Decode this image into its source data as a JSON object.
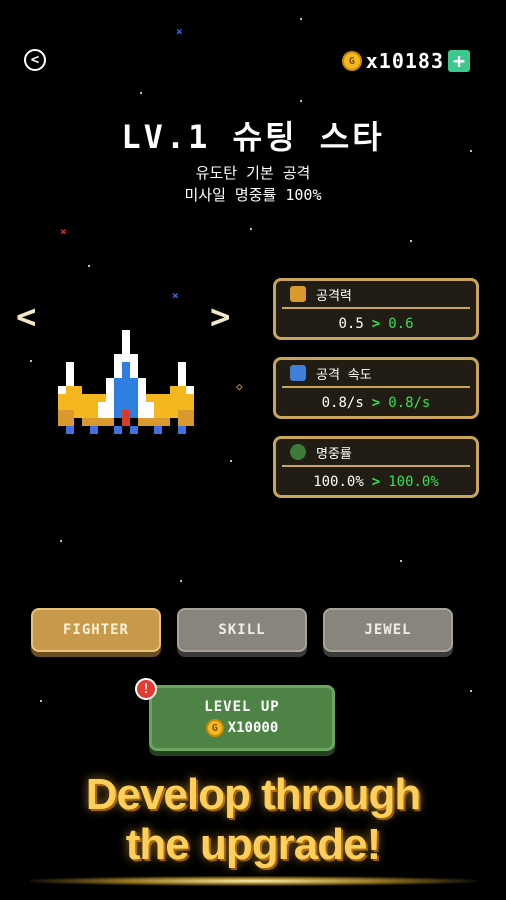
{
  "header": {
    "back_icon": "back-arrow-icon",
    "coin_icon_glyph": "G",
    "coin_count": "x10183",
    "plus_label": "+"
  },
  "ship": {
    "title": "LV.1 슈팅 스타",
    "desc_line1": "유도탄 기본 공격",
    "desc_line2": "미사일 명중률 100%"
  },
  "nav": {
    "prev": "<",
    "next": ">"
  },
  "stats": [
    {
      "label": "공격력",
      "current": "0.5",
      "next": "0.6",
      "icon": "attack-power-icon",
      "icon_color": "#d89a2c"
    },
    {
      "label": "공격 속도",
      "current": "0.8/s",
      "next": "0.8/s",
      "icon": "attack-speed-icon",
      "icon_color": "#3f7fd8"
    },
    {
      "label": "명중률",
      "current": "100.0%",
      "next": "100.0%",
      "icon": "accuracy-icon",
      "icon_color": "#3e7a3a"
    }
  ],
  "tabs": {
    "fighter": "FIGHTER",
    "skill": "SKILL",
    "jewel": "JEWEL",
    "active": "fighter"
  },
  "level_up": {
    "label": "LEVEL UP",
    "cost": "X10000",
    "alert": "!"
  },
  "promo": {
    "line1": "Develop through",
    "line2": "the upgrade!"
  },
  "colors": {
    "gold": "#c9a55a",
    "green": "#35e04d",
    "button_green": "#4d8446",
    "coin": "#f5b820"
  }
}
